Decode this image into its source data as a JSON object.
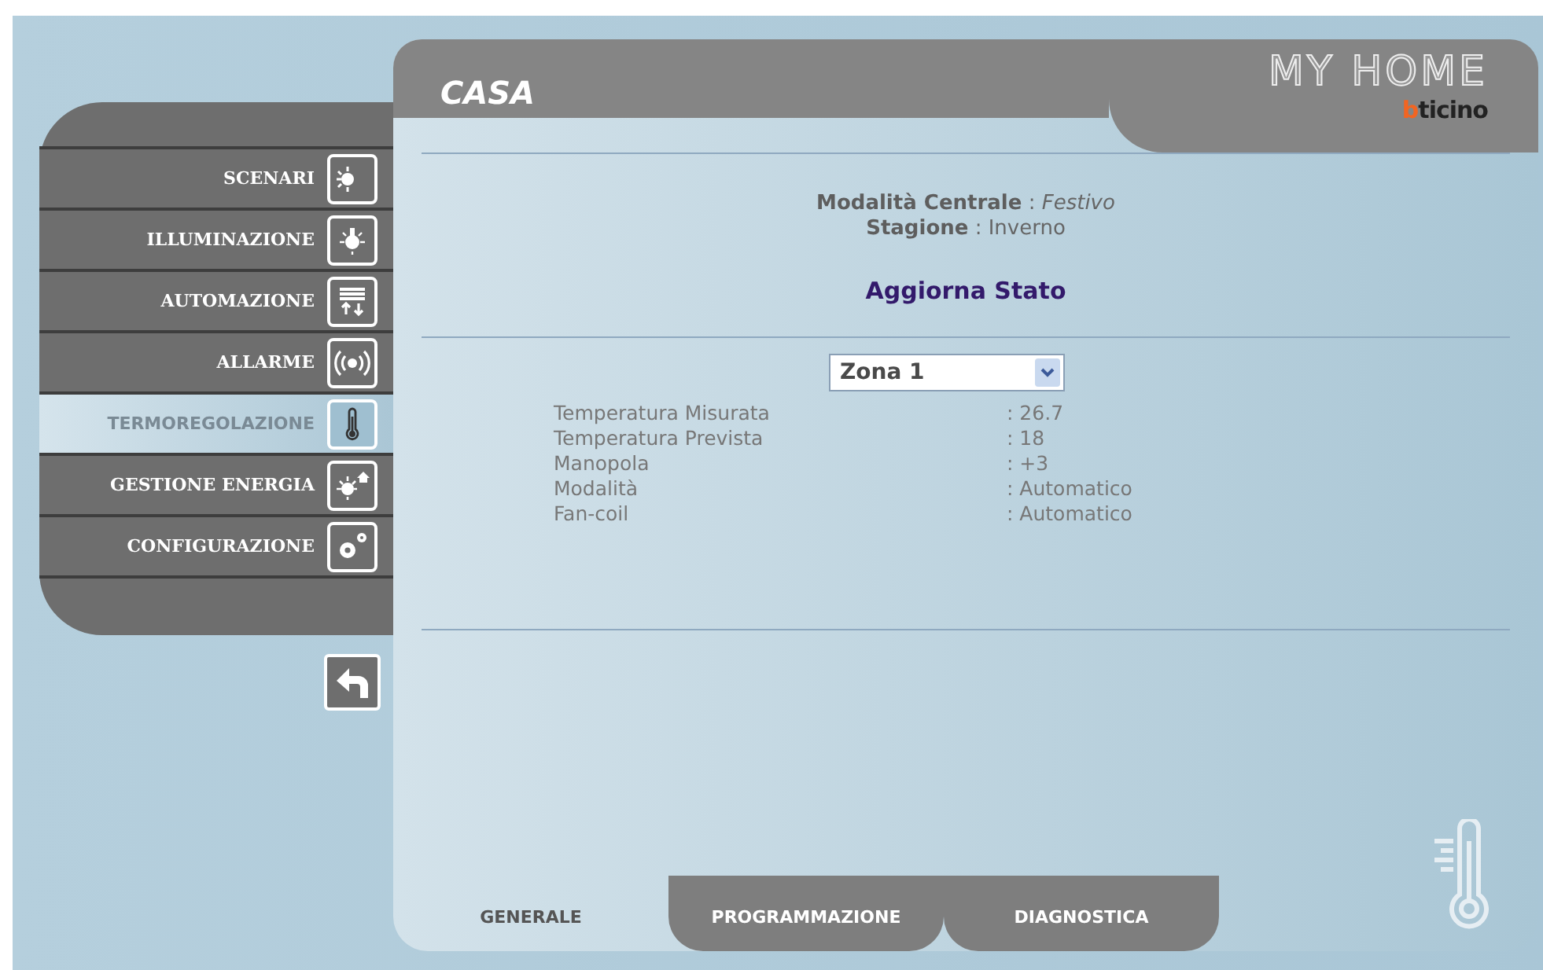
{
  "sidebar": {
    "items": [
      {
        "label": "SCENARI",
        "selected": false
      },
      {
        "label": "ILLUMINAZIONE",
        "selected": false
      },
      {
        "label": "AUTOMAZIONE",
        "selected": false
      },
      {
        "label": "ALLARME",
        "selected": false
      },
      {
        "label": "TERMOREGOLAZIONE",
        "selected": true
      },
      {
        "label": "GESTIONE ENERGIA",
        "selected": false
      },
      {
        "label": "CONFIGURAZIONE",
        "selected": false
      }
    ]
  },
  "header": {
    "title": "CASA",
    "logo": "MY HOME",
    "brand": "bticino"
  },
  "status": [
    "**Modalità Centrale** : *Festivo*",
    "**Stagione** : Inverno"
  ],
  "refresh_link": "Aggiorna Stato",
  "zone_select": {
    "value": "Zona 1"
  },
  "readings": [
    {
      "label": "Temperatura Misurata",
      "value": ": 26.7"
    },
    {
      "label": "Temperatura Prevista",
      "value": ": 18"
    },
    {
      "label": "Manopola",
      "value": ": +3"
    },
    {
      "label": "Modalità",
      "value": ": Automatico"
    },
    {
      "label": "Fan-coil",
      "value": ": Automatico"
    }
  ],
  "tabs": [
    {
      "label": "GENERALE",
      "selected": true
    },
    {
      "label": "PROGRAMMAZIONE",
      "selected": false
    },
    {
      "label": "DIAGNOSTICA",
      "selected": false
    }
  ]
}
